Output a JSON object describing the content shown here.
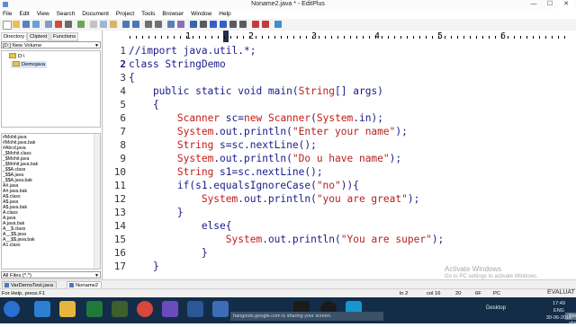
{
  "window": {
    "title": "Noname2.java * - EditPlus",
    "minimize": "—",
    "maximize": "☐",
    "close": "✕"
  },
  "menu": [
    "File",
    "Edit",
    "View",
    "Search",
    "Document",
    "Project",
    "Tools",
    "Browser",
    "Window",
    "Help"
  ],
  "left_panel": {
    "tabs": [
      "Directory",
      "Cliptext",
      "Functions"
    ],
    "drive": "[D:] New Volume",
    "dirs": [
      "D:\\",
      "Demojava"
    ],
    "files": [
      "#Mohit.java",
      "#Mohit.java.bak",
      "#Abcd.java",
      "_$Mohit.class",
      "_$Mohit.java",
      "_$Mohit.java.bak",
      "_$$A.class",
      "_$$A.java",
      "_$$A.java.bak",
      "A#.java",
      "A#.java.bak",
      "A$.class",
      "A$.java",
      "A$.java.bak",
      "A.class",
      "A.java",
      "A.java.bak",
      "A__$.class",
      "A__$$.java",
      "A__$$.java.bak",
      "A1.class"
    ],
    "filter": "All Files (*.*)"
  },
  "ruler": {
    "numbers": [
      "1",
      "2",
      "3",
      "4",
      "5",
      "6"
    ]
  },
  "editor": {
    "line_numbers": [
      "1",
      "2",
      "3",
      "4",
      "5",
      "6",
      "7",
      "8",
      "9",
      "10",
      "11",
      "12",
      "13",
      "14",
      "15",
      "16",
      "17"
    ],
    "current_line": "2",
    "lines": {
      "l1": "//import java.util.*;",
      "l2a": "class ",
      "l2b": "StringDemo",
      "l3": "{",
      "l4a": "    public static void ",
      "l4b": "main(",
      "l4c": "String",
      "l4d": "[] args)",
      "l5": "    {",
      "l6a": "        ",
      "l6b": "Scanner",
      "l6c": " sc=",
      "l6d": "new",
      "l6e": " ",
      "l6f": "Scanner",
      "l6g": "(",
      "l6h": "System",
      "l6i": ".in);",
      "l7a": "        ",
      "l7b": "System",
      "l7c": ".out.println(",
      "l7d": "\"Enter your name\"",
      "l7e": ");",
      "l8a": "        ",
      "l8b": "String",
      "l8c": " s=sc.nextLine();",
      "l9a": "        ",
      "l9b": "System",
      "l9c": ".out.println(",
      "l9d": "\"Do u have name\"",
      "l9e": ");",
      "l10a": "        ",
      "l10b": "String",
      "l10c": " s1=sc.nextLine();",
      "l11a": "        if(s1.equalsIgnoreCase(",
      "l11b": "\"no\"",
      "l11c": ")){",
      "l12a": "            ",
      "l12b": "System",
      "l12c": ".out.println(",
      "l12d": "\"you are great\"",
      "l12e": ");",
      "l13": "        }",
      "l14": "            else{",
      "l15a": "                ",
      "l15b": "System",
      "l15c": ".out.println(",
      "l15d": "\"You are super\"",
      "l15e": ");",
      "l16": "            }",
      "l17": "    }"
    }
  },
  "watermark": {
    "title": "Activate Windows",
    "sub": "Go to PC settings to activate Windows."
  },
  "doc_tabs": [
    "VarDemoTest.java",
    "Noname2"
  ],
  "status": {
    "help": "For Help, press F1",
    "ln": "ln 2",
    "col": "col 16",
    "count": "20",
    "pc": "PC",
    "eol": "6F",
    "evaluation": "EVALUAT"
  },
  "taskbar": {
    "share_text": "hangouts.google.com is sharing your screen.",
    "stop_sharing": "Stop sharing",
    "desktop": "Desktop",
    "time": "17:49",
    "date": "30-06-2016",
    "lang": "ENG"
  },
  "colors": {
    "keyword": "#1a1a8c",
    "class": "#c41a16",
    "string": "#b22222",
    "taskbar": "#132d49"
  }
}
